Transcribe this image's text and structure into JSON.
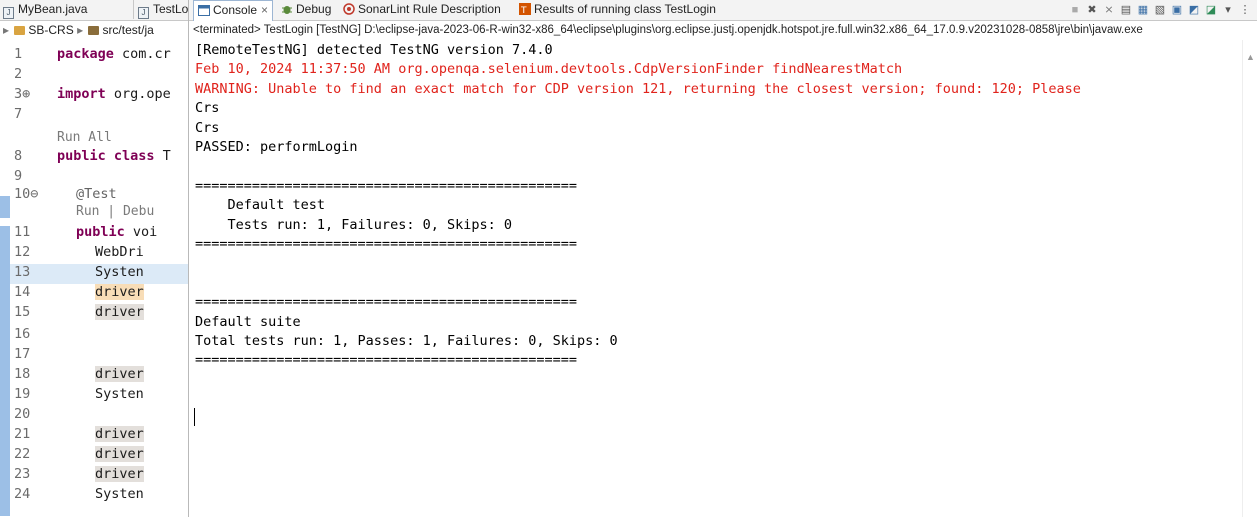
{
  "editor": {
    "tabs": [
      {
        "label": "MyBean.java"
      },
      {
        "label": "TestLo"
      }
    ],
    "breadcrumb": {
      "project": "SB-CRS",
      "path": "src/test/ja"
    },
    "code_lines": [
      {
        "num": "1",
        "text": "package com.cr"
      },
      {
        "num": "2",
        "text": ""
      },
      {
        "num": "3⊕",
        "text": "import org.ope"
      },
      {
        "num": "7",
        "text": ""
      },
      {
        "num": "",
        "text": "Run All"
      },
      {
        "num": "8",
        "text": "public class T"
      },
      {
        "num": "9",
        "text": ""
      },
      {
        "num": "10⊖",
        "text": "@Test"
      },
      {
        "num": "",
        "text": "Run | Debu"
      },
      {
        "num": "11",
        "text": "public voi"
      },
      {
        "num": "12",
        "text": "WebDri"
      },
      {
        "num": "13",
        "text": "Systen"
      },
      {
        "num": "14",
        "text": "driver"
      },
      {
        "num": "15",
        "text": "driver"
      },
      {
        "num": "16",
        "text": ""
      },
      {
        "num": "17",
        "text": ""
      },
      {
        "num": "18",
        "text": "driver"
      },
      {
        "num": "19",
        "text": "Systen"
      },
      {
        "num": "20",
        "text": ""
      },
      {
        "num": "21",
        "text": "driver"
      },
      {
        "num": "22",
        "text": "driver"
      },
      {
        "num": "23",
        "text": "driver"
      },
      {
        "num": "24",
        "text": "Systen"
      }
    ]
  },
  "console": {
    "tabs": [
      {
        "label": "Console",
        "close": "×"
      },
      {
        "label": "Debug"
      },
      {
        "label": "SonarLint Rule Description"
      },
      {
        "label": "Results of running class TestLogin"
      }
    ],
    "header": "<terminated> TestLogin [TestNG] D:\\eclipse-java-2023-06-R-win32-x86_64\\eclipse\\plugins\\org.eclipse.justj.openjdk.hotspot.jre.full.win32.x86_64_17.0.9.v20231028-0858\\jre\\bin\\javaw.exe",
    "lines": [
      "[RemoteTestNG] detected TestNG version 7.4.0",
      "Feb 10, 2024 11:37:50 AM org.openqa.selenium.devtools.CdpVersionFinder findNearestMatch",
      "WARNING: Unable to find an exact match for CDP version 121, returning the closest version; found: 120; Please",
      "Crs",
      "Crs",
      "PASSED: performLogin",
      "",
      "===============================================",
      "    Default test",
      "    Tests run: 1, Failures: 0, Skips: 0",
      "===============================================",
      "",
      "",
      "===============================================",
      "Default suite",
      "Total tests run: 1, Passes: 1, Failures: 0, Skips: 0",
      "==============================================="
    ],
    "toolbar_icons": [
      "stop-icon",
      "remove-launch-icon",
      "remove-all-icon",
      "scroll-lock-icon",
      "word-wrap-icon",
      "pin-icon",
      "display-console-icon",
      "new-console-icon",
      "view-menu-icon"
    ]
  },
  "colors": {
    "error": "#e0231c",
    "keyword": "#7f0055",
    "selection_line": "#dceaf7"
  }
}
